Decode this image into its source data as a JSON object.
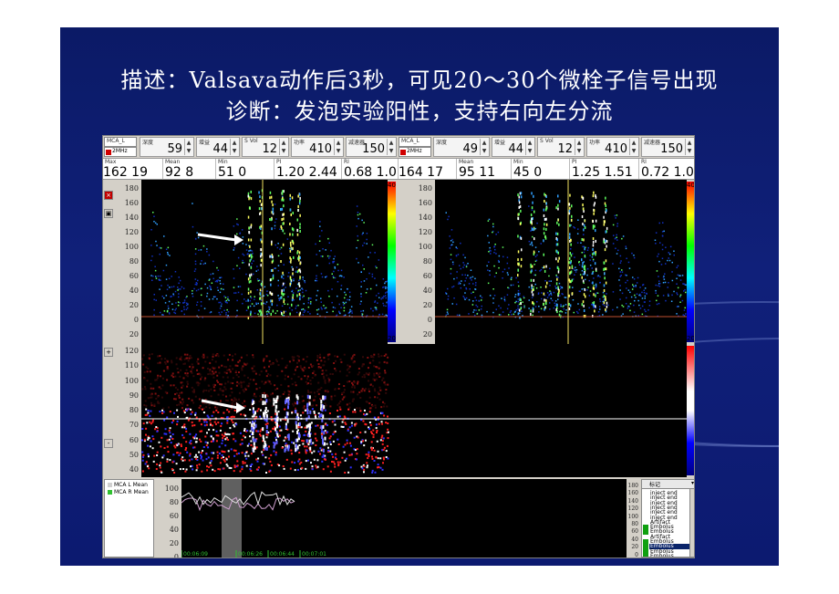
{
  "slide": {
    "title_line1": "描述：Valsava动作后3秒，可见20～30个微栓子信号出现",
    "title_line2": "诊断：发泡实验阳性，支持右向左分流"
  },
  "left_params": {
    "channel": "MCA_L",
    "probe": "2MHz",
    "p1_label": "深度",
    "p1": "59",
    "p2_label": "增益",
    "p2": "44",
    "p3_label": "S Vol",
    "p3": "12",
    "p4_label": "功率",
    "p4": "410",
    "p5_label": "减速器",
    "p5": "150"
  },
  "right_params": {
    "channel": "MCA_L",
    "probe": "2MHz",
    "p1_label": "深度",
    "p1": "49",
    "p2_label": "增益",
    "p2": "44",
    "p3_label": "S Vol",
    "p3": "12",
    "p4_label": "功率",
    "p4": "410",
    "p5_label": "减速器",
    "p5": "150"
  },
  "left_metrics": {
    "max_label": "Max",
    "max": "162 19",
    "mean_label": "Mean",
    "mean": "92  8",
    "min_label": "Min",
    "min": "51  0",
    "pi_label": "PI",
    "pi": "1.20  2.44",
    "ri_label": "RI",
    "ri": "0.68  1.0"
  },
  "right_metrics": {
    "max": "164 17",
    "mean_label": "Mean",
    "mean": "95  11",
    "min_label": "Min",
    "min": "45  0",
    "pi_label": "PI",
    "pi": "1.25  1.51",
    "ri_label": "RI",
    "ri": "0.72  1.0"
  },
  "spectrum_axis": [
    "180",
    "160",
    "140",
    "120",
    "100",
    "80",
    "60",
    "40",
    "20",
    "0",
    "20"
  ],
  "mmode_axis": [
    "120",
    "110",
    "100",
    "90",
    "80",
    "70",
    "60",
    "50",
    "40"
  ],
  "colorbar_top": "40",
  "colorbar_bottom": "20",
  "trend": {
    "axis": [
      "100",
      "80",
      "60",
      "40",
      "20",
      "0"
    ],
    "times": [
      "00:06:09",
      "00:06:26",
      "00:06:44",
      "00:07:01"
    ],
    "legend": [
      {
        "label": "MCA L Mean",
        "color": "#d0d0d0"
      },
      {
        "label": "MCA R Mean",
        "color": "#30c030"
      }
    ]
  },
  "events": {
    "header": "标记",
    "axis": [
      "180",
      "160",
      "140",
      "120",
      "100",
      "80",
      "60",
      "40",
      "20",
      "0"
    ],
    "items": [
      {
        "label": "inject end",
        "color": "#ffffff"
      },
      {
        "label": "inject end",
        "color": "#ffffff"
      },
      {
        "label": "inject end",
        "color": "#ffffff"
      },
      {
        "label": "inject end",
        "color": "#ffffff"
      },
      {
        "label": "inject end",
        "color": "#ffffff"
      },
      {
        "label": "inject end",
        "color": "#ffffff"
      },
      {
        "label": "Artifact",
        "color": "#ffffff"
      },
      {
        "label": "Embolus",
        "color": "#10a010"
      },
      {
        "label": "Embolus",
        "color": "#10a010"
      },
      {
        "label": "Artifact",
        "color": "#ffffff"
      },
      {
        "label": "Embolus",
        "color": "#10a010"
      },
      {
        "label": "Embolus",
        "color": "#10a010",
        "selected": true
      },
      {
        "label": "Embolus",
        "color": "#10a010"
      },
      {
        "label": "Embolus",
        "color": "#10a010"
      }
    ]
  }
}
